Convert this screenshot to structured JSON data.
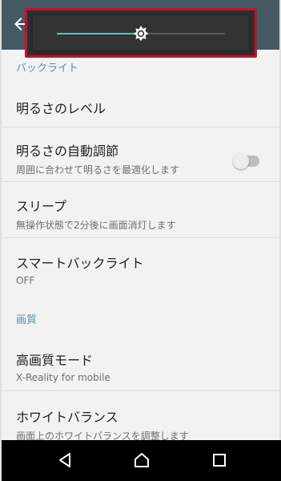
{
  "colors": {
    "accent": "#59c2b6",
    "section_header": "#5c8fa3",
    "highlight_border": "#c8102e"
  },
  "brightness": {
    "level": 0.5
  },
  "sections": [
    {
      "header": "バックライト"
    },
    {
      "header": "画質"
    }
  ],
  "items": {
    "brightness_level": {
      "title": "明るさのレベル"
    },
    "auto_brightness": {
      "title": "明るさの自動調節",
      "subtitle": "周囲に合わせて明るさを最適化します",
      "enabled": false
    },
    "sleep": {
      "title": "スリープ",
      "subtitle": "無操作状態で2分後に画面消灯します"
    },
    "smart_backlight": {
      "title": "スマートバックライト",
      "subtitle": "OFF"
    },
    "hq_mode": {
      "title": "高画質モード",
      "subtitle": "X-Reality for mobile"
    },
    "white_balance": {
      "title": "ホワイトバランス",
      "subtitle": "画面上のホワイトバランスを調整します"
    }
  },
  "icons": {
    "back": "back-arrow-icon",
    "brightness": "brightness-icon",
    "nav_back": "nav-back-icon",
    "nav_home": "nav-home-icon",
    "nav_recents": "nav-recents-icon"
  }
}
